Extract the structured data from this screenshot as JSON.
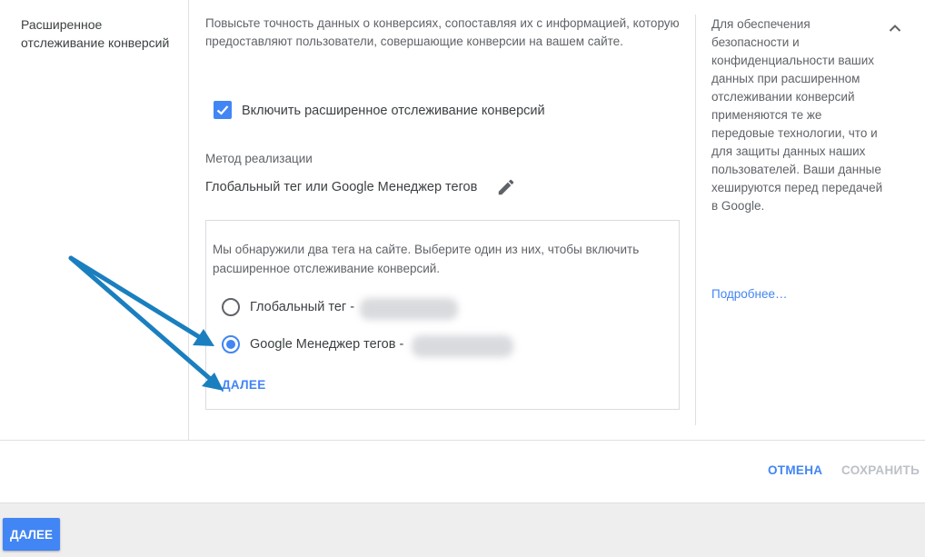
{
  "section": {
    "title": "Расширенное отслеживание конверсий",
    "description": "Повысьте точность данных о конверсиях, сопоставляя их с информацией, которую предоставляют пользователи, совершающие конверсии на вашем сайте."
  },
  "checkbox": {
    "label": "Включить расширенное отслеживание конверсий",
    "checked": true
  },
  "method": {
    "label": "Метод реализации",
    "value": "Глобальный тег или Google Менеджер тегов",
    "edit_icon": "pencil-icon"
  },
  "tag_box": {
    "text": "Мы обнаружили два тега на сайте. Выберите один из них, чтобы включить расширенное отслеживание конверсий.",
    "options": [
      {
        "label": "Глобальный тег -",
        "selected": false
      },
      {
        "label": "Google Менеджер тегов -",
        "selected": true
      }
    ],
    "next_label": "ДАЛЕЕ"
  },
  "help": {
    "text": "Для обеспечения безопасности и конфиденциальности ваших данных при расширенном отслеживании конверсий применяются те же передовые технологии, что и для защиты данных наших пользователей. Ваши данные хешируются перед передачей в Google.",
    "link": "Подробнее…"
  },
  "actions": {
    "cancel": "ОТМЕНА",
    "save": "СОХРАНИТЬ"
  },
  "footer": {
    "next": "ДАЛЕЕ"
  },
  "colors": {
    "accent": "#4285f4",
    "arrow": "#1a7fbf",
    "disabled": "#bdc1c6"
  }
}
